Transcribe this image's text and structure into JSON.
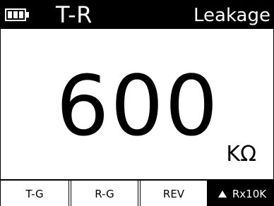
{
  "header": {
    "battery_icon": "battery-full-icon",
    "test_mode": "T-R",
    "test_type": "Leakage"
  },
  "reading": {
    "value": "600",
    "unit": "KΩ"
  },
  "softkeys": [
    {
      "label": "T-G",
      "active": false
    },
    {
      "label": "R-G",
      "active": false
    },
    {
      "label": "REV",
      "active": false
    },
    {
      "label": "Rx10K",
      "active": true,
      "icon": "triangle-up-icon"
    }
  ],
  "colors": {
    "background": "#ffffff",
    "foreground": "#000000"
  }
}
